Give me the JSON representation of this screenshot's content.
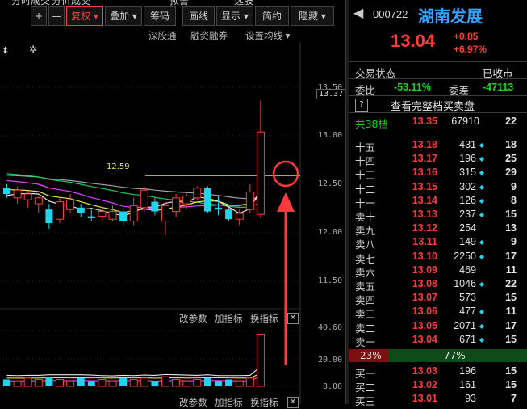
{
  "toolbar": {
    "top_labels": [
      "分时成交",
      "分价成交",
      "预警",
      "选股"
    ],
    "buttons": [
      "+",
      "—",
      "复权",
      "叠加",
      "筹码",
      "画线",
      "显示",
      "简约",
      "隐藏"
    ],
    "selected": "复权",
    "sub_links": [
      "深股通",
      "融资融券",
      "设置均线"
    ]
  },
  "price_axis": {
    "ticks": [
      "13.50",
      "13.00",
      "12.50",
      "12.00",
      "11.50"
    ],
    "current": "13.37"
  },
  "ma_label": "12.59",
  "volume_panel": {
    "links": [
      "改参数",
      "加指标",
      "换指标"
    ],
    "ticks": [
      "40.60",
      "20.00",
      "0.00"
    ],
    "bottom_links": [
      "改参数",
      "加指标",
      "换指标"
    ]
  },
  "quote": {
    "code": "000722",
    "name": "湖南发展",
    "price": "13.04",
    "change": "+0.85",
    "change_pct": "+6.97%",
    "status_label": "交易状态",
    "status_value": "已收市",
    "ratio_label": "委比",
    "ratio_value": "-53.11%",
    "diff_label": "委差",
    "diff_value": "-47113",
    "full_book_button": "查看完整档买卖盘",
    "summary": {
      "label": "共38档",
      "price": "13.35",
      "volume": "67910",
      "count": "22"
    }
  },
  "order_book": {
    "asks": [
      {
        "label": "十五",
        "price": "13.18",
        "volume": "431",
        "count": "18",
        "marked": true
      },
      {
        "label": "十四",
        "price": "13.17",
        "volume": "196",
        "count": "25",
        "marked": true
      },
      {
        "label": "十三",
        "price": "13.16",
        "volume": "315",
        "count": "29",
        "marked": true
      },
      {
        "label": "十二",
        "price": "13.15",
        "volume": "302",
        "count": "9",
        "marked": true
      },
      {
        "label": "十一",
        "price": "13.14",
        "volume": "126",
        "count": "8",
        "marked": true
      },
      {
        "label": "卖十",
        "price": "13.13",
        "volume": "237",
        "count": "15",
        "marked": true
      },
      {
        "label": "卖九",
        "price": "13.12",
        "volume": "254",
        "count": "13",
        "marked": false
      },
      {
        "label": "卖八",
        "price": "13.11",
        "volume": "149",
        "count": "9",
        "marked": true
      },
      {
        "label": "卖七",
        "price": "13.10",
        "volume": "2250",
        "count": "17",
        "marked": true
      },
      {
        "label": "卖六",
        "price": "13.09",
        "volume": "469",
        "count": "11",
        "marked": false
      },
      {
        "label": "卖五",
        "price": "13.08",
        "volume": "1046",
        "count": "22",
        "marked": true
      },
      {
        "label": "卖四",
        "price": "13.07",
        "volume": "573",
        "count": "15",
        "marked": false
      },
      {
        "label": "卖三",
        "price": "13.06",
        "volume": "477",
        "count": "11",
        "marked": true
      },
      {
        "label": "卖二",
        "price": "13.05",
        "volume": "2071",
        "count": "17",
        "marked": true
      },
      {
        "label": "卖一",
        "price": "13.04",
        "volume": "671",
        "count": "15",
        "marked": true
      }
    ],
    "ratio_bar": {
      "buy": "23%",
      "sell": "77%"
    },
    "bids": [
      {
        "label": "买一",
        "price": "13.03",
        "volume": "196",
        "count": "15"
      },
      {
        "label": "买二",
        "price": "13.02",
        "volume": "161",
        "count": "15"
      },
      {
        "label": "买三",
        "price": "13.01",
        "volume": "93",
        "count": "7"
      }
    ]
  },
  "candles": [
    {
      "o": 12.46,
      "c": 12.4,
      "h": 12.5,
      "l": 12.36
    },
    {
      "o": 12.36,
      "c": 12.44,
      "h": 12.48,
      "l": 12.3
    },
    {
      "o": 12.34,
      "c": 12.4,
      "h": 12.43,
      "l": 12.26
    },
    {
      "o": 12.3,
      "c": 12.36,
      "h": 12.38,
      "l": 12.2
    },
    {
      "o": 12.24,
      "c": 12.1,
      "h": 12.3,
      "l": 12.04
    },
    {
      "o": 12.14,
      "c": 12.32,
      "h": 12.36,
      "l": 12.1
    },
    {
      "o": 12.24,
      "c": 12.34,
      "h": 12.4,
      "l": 12.2
    },
    {
      "o": 12.26,
      "c": 12.2,
      "h": 12.3,
      "l": 12.16
    },
    {
      "o": 12.17,
      "c": 12.15,
      "h": 12.24,
      "l": 12.12
    },
    {
      "o": 12.17,
      "c": 12.22,
      "h": 12.26,
      "l": 12.12
    },
    {
      "o": 12.14,
      "c": 12.22,
      "h": 12.28,
      "l": 12.12
    },
    {
      "o": 12.22,
      "c": 12.12,
      "h": 12.24,
      "l": 12.08
    },
    {
      "o": 12.12,
      "c": 12.28,
      "h": 12.36,
      "l": 12.08
    },
    {
      "o": 12.26,
      "c": 12.44,
      "h": 12.48,
      "l": 12.22
    },
    {
      "o": 12.32,
      "c": 12.22,
      "h": 12.36,
      "l": 12.18
    },
    {
      "o": 12.12,
      "c": 12.28,
      "h": 12.32,
      "l": 11.98
    },
    {
      "o": 12.22,
      "c": 12.36,
      "h": 12.4,
      "l": 12.16
    },
    {
      "o": 12.3,
      "c": 12.38,
      "h": 12.42,
      "l": 12.24
    },
    {
      "o": 12.36,
      "c": 12.46,
      "h": 12.48,
      "l": 12.34
    },
    {
      "o": 12.46,
      "c": 12.22,
      "h": 12.48,
      "l": 12.2
    },
    {
      "o": 12.26,
      "c": 12.24,
      "h": 12.38,
      "l": 12.18
    },
    {
      "o": 12.24,
      "c": 12.14,
      "h": 12.26,
      "l": 12.12
    },
    {
      "o": 12.14,
      "c": 12.2,
      "h": 12.24,
      "l": 12.08
    },
    {
      "o": 12.24,
      "c": 12.42,
      "h": 12.5,
      "l": 12.2
    },
    {
      "o": 12.19,
      "c": 13.04,
      "h": 13.37,
      "l": 12.15
    }
  ],
  "colors": {
    "up": "#ff3b3b",
    "down": "#22d3ee",
    "ma5": "#e8e8e8",
    "ma10": "#e8e84a",
    "ma20": "#e040fb",
    "ma30": "#22c55e",
    "ma60": "#9ca3af",
    "annotation": "#ff3b3b"
  }
}
